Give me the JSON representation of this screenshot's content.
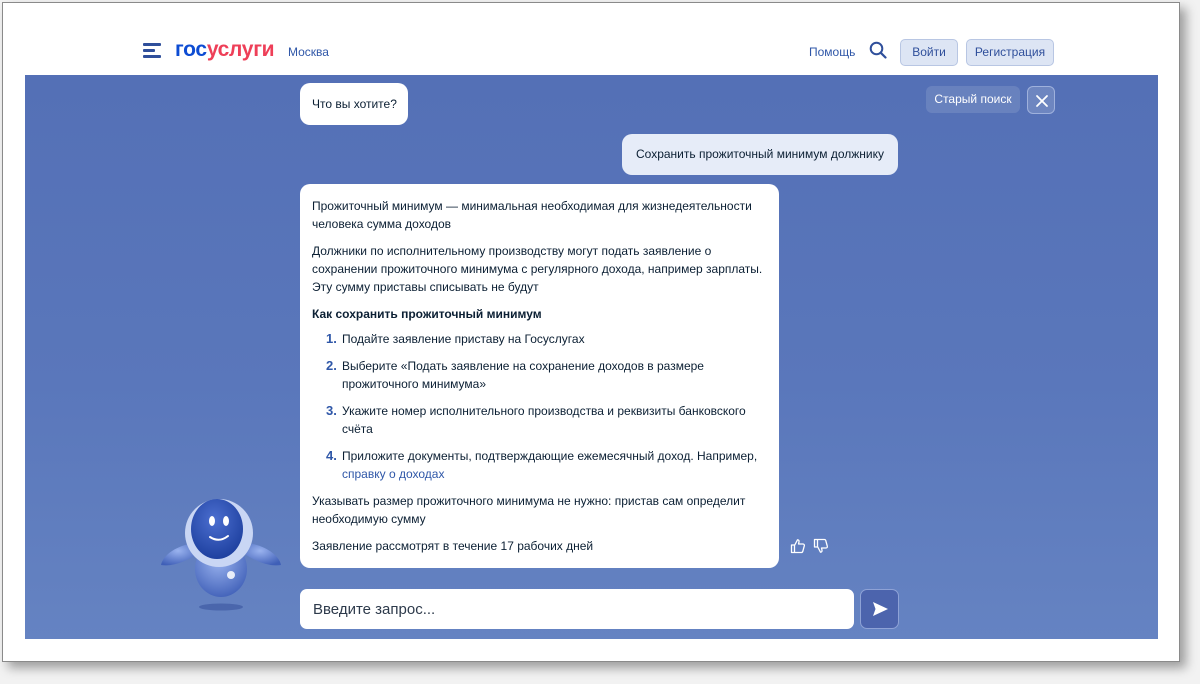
{
  "header": {
    "logo_part1": "гос",
    "logo_part2": "услуги",
    "region": "Москва",
    "help_label": "Помощь",
    "login_label": "Войти",
    "register_label": "Регистрация"
  },
  "chat": {
    "bot_question": "Что вы хотите?",
    "old_search_label": "Старый поиск",
    "user_message": "Сохранить прожиточный минимум должнику",
    "answer": {
      "intro": "Прожиточный минимум — минимальная необходимая для жизнедеятельности человека сумма доходов",
      "paragraph": "Должники по исполнительному производству могут подать заявление о сохранении прожиточного минимума с регулярного дохода, например зарплаты. Эту сумму приставы списывать не будут",
      "heading": "Как сохранить прожиточный минимум",
      "steps": [
        {
          "num": "1.",
          "text": "Подайте заявление приставу на Госуслугах"
        },
        {
          "num": "2.",
          "text": "Выберите «Подать заявление на сохранение доходов в размере прожиточного минимума»"
        },
        {
          "num": "3.",
          "text": "Укажите номер исполнительного производства и реквизиты банковского счёта"
        },
        {
          "num": "4.",
          "text": "Приложите документы, подтверждающие ежемесячный доход. Например, ",
          "link": "справку о доходах"
        }
      ],
      "note": "Указывать размер прожиточного минимума не нужно: пристав сам определит необходимую сумму",
      "deadline": "Заявление рассмотрят в течение 17 рабочих дней"
    },
    "input_placeholder": "Введите запрос..."
  },
  "icons": {
    "menu": "menu-icon",
    "search": "search-icon",
    "close": "close-icon",
    "like": "thumbs-up-icon",
    "dislike": "thumbs-down-icon",
    "send": "send-icon",
    "mascot": "robot-mascot"
  },
  "colors": {
    "brand_blue": "#0d4cd3",
    "brand_red": "#ee3f58",
    "background_blue": "#5a77bb",
    "link": "#2f57a8"
  }
}
